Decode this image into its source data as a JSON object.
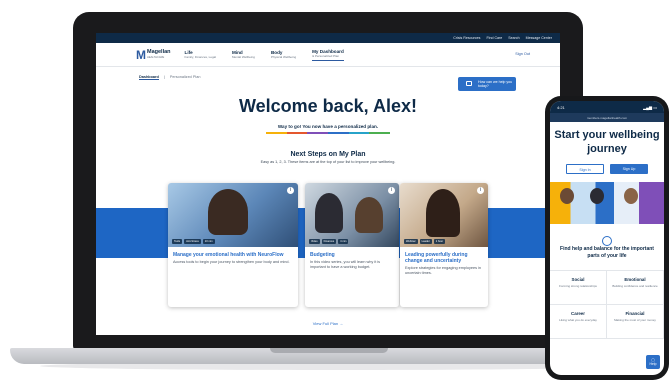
{
  "laptop": {
    "utility_bar": {
      "crisis": "Crisis Resources",
      "find_care": "Find Care",
      "search": "Search",
      "message_center": "Message Center"
    },
    "nav": {
      "logo_name": "Magellan",
      "logo_sub": "HEALTHCARE",
      "items": [
        {
          "title": "Life",
          "sub": "Family, Finances, Legal"
        },
        {
          "title": "Mind",
          "sub": "Mental Wellbeing"
        },
        {
          "title": "Body",
          "sub": "Physical Wellbeing"
        },
        {
          "title": "My Dashboard",
          "sub": "& Personalized Plan"
        }
      ],
      "sign_out": "Sign Out"
    },
    "breadcrumb": {
      "current": "Dashboard",
      "next": "Personalized Plan"
    },
    "help_button": "How can we help you today?",
    "welcome": "Welcome back, Alex!",
    "welcome_sub": "Way to go! You now have a personalized plan.",
    "rainbow_colors": [
      "#f6b10a",
      "#e4572e",
      "#7f4fb8",
      "#2c6fc7",
      "#27a3c9",
      "#4caf50"
    ],
    "next_steps": {
      "title": "Next Steps on My Plan",
      "subtitle": "Easy as 1, 2, 3. These items are at the top of your list to improve your wellbeing."
    },
    "cards": [
      {
        "title": "Manage your emotional health with NeuroFlow",
        "desc": "Access tools to begin your journey to strengthen your body and mind.",
        "tags": [
          "Tools",
          "Anti-Stress",
          "10 min"
        ]
      },
      {
        "title": "Budgeting",
        "desc": "In this video series, you will learn why it is important to have a working budget.",
        "tags": [
          "Video",
          "Finances",
          "4 min"
        ]
      },
      {
        "title": "Leading powerfully during change and uncertainty",
        "desc": "Explore strategies for engaging employees in uncertain times.",
        "tags": [
          "Webinar",
          "Leader",
          "1 hour"
        ]
      }
    ],
    "view_full_plan": "View Full Plan →"
  },
  "phone": {
    "time": "4:21",
    "url": "members.magellanhealth.com",
    "title": "Start your wellbeing journey",
    "sign_in": "Sign In",
    "sign_up": "Sign Up",
    "find_help": "Find help and balance for the important parts of your life",
    "categories": [
      {
        "title": "Social",
        "desc": "Forming strong relationships"
      },
      {
        "title": "Emotional",
        "desc": "Building confidence and resilience"
      },
      {
        "title": "Career",
        "desc": "Liking what you do everyday"
      },
      {
        "title": "Financial",
        "desc": "Making the most of your money"
      }
    ],
    "help": "Help"
  }
}
